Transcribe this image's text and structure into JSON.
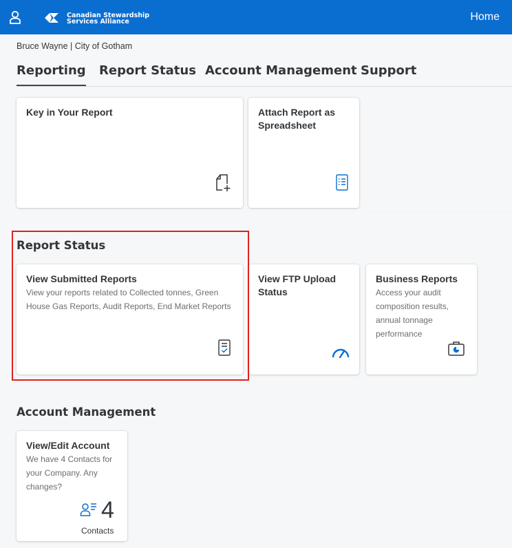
{
  "header": {
    "company_line1": "Canadian Stewardship",
    "company_line2": "Services Alliance",
    "home_label": "Home"
  },
  "user_line": "Bruce Wayne | City of Gotham",
  "tabs": [
    {
      "label": "Reporting",
      "active": true
    },
    {
      "label": "Report Status",
      "active": false
    },
    {
      "label": "Account Management",
      "active": false
    },
    {
      "label": "Support",
      "active": false
    }
  ],
  "reporting": {
    "tiles": [
      {
        "title": "Key in Your Report",
        "icon": "new-document-icon"
      },
      {
        "title": "Attach Report as Spreadsheet",
        "icon": "list-document-icon"
      }
    ]
  },
  "report_status": {
    "title": "Report Status",
    "tiles": [
      {
        "title": "View Submitted Reports",
        "subtitle": "View your reports related to Collected tonnes, Green House Gas Reports, Audit Reports, End Market Reports",
        "icon": "approved-document-icon"
      },
      {
        "title": "View FTP Upload Status",
        "icon": "speedometer-icon"
      },
      {
        "title": "Business Reports",
        "subtitle": "Access your audit composition results, annual tonnage performance",
        "icon": "business-report-icon"
      }
    ]
  },
  "account_management": {
    "title": "Account Management",
    "tiles": [
      {
        "title": "View/Edit Account",
        "subtitle": "We have 4 Contacts for your Company. Any changes?",
        "kpi_value": "4",
        "kpi_unit": "Contacts",
        "icon": "contacts-icon"
      }
    ]
  },
  "colors": {
    "shellbar": "#0a6ed1",
    "icon_blue": "#0a6ed1",
    "highlight_red": "#e0211f"
  }
}
